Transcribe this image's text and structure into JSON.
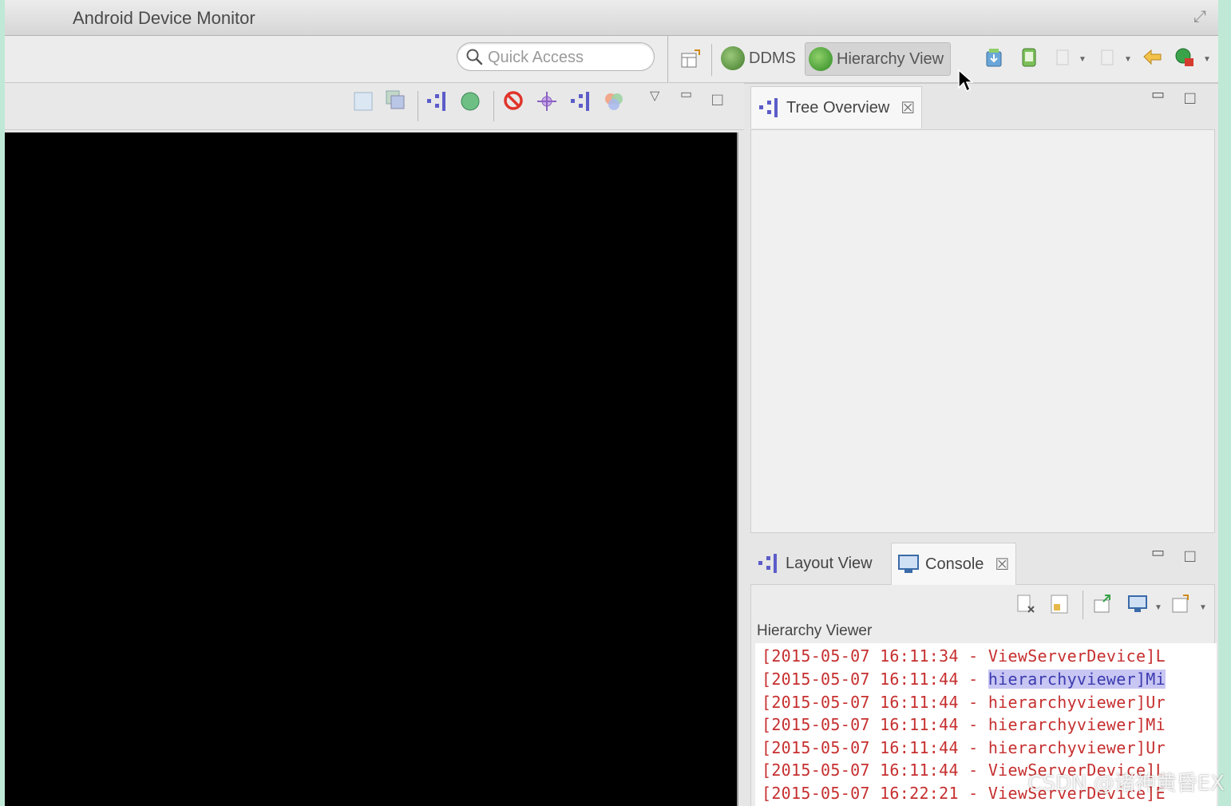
{
  "window": {
    "title": "Android Device Monitor"
  },
  "toolbar": {
    "quick_access_placeholder": "Quick Access",
    "perspectives": [
      {
        "label": "DDMS",
        "icon": "ddms-icon"
      },
      {
        "label": "Hierarchy View",
        "icon": "hierarchy-view-icon",
        "active": true
      }
    ]
  },
  "tree_overview": {
    "tab_label": "Tree Overview"
  },
  "bottom_panel": {
    "tabs": [
      {
        "label": "Layout View"
      },
      {
        "label": "Console",
        "active": true
      }
    ],
    "console_title": "Hierarchy Viewer",
    "log_lines": [
      {
        "prefix": "[2015-05-07 16:11:34 - ",
        "source": "ViewServerDevice]L"
      },
      {
        "prefix": "[2015-05-07 16:11:44 - ",
        "source": "hierarchyviewer]Mi",
        "highlighted": true
      },
      {
        "prefix": "[2015-05-07 16:11:44 - ",
        "source": "hierarchyviewer]Ur"
      },
      {
        "prefix": "[2015-05-07 16:11:44 - ",
        "source": "hierarchyviewer]Mi"
      },
      {
        "prefix": "[2015-05-07 16:11:44 - ",
        "source": "hierarchyviewer]Ur"
      },
      {
        "prefix": "[2015-05-07 16:11:44 - ",
        "source": "ViewServerDevice]L"
      },
      {
        "prefix": "[2015-05-07 16:22:21 - ",
        "source": "ViewServerDevice]E"
      }
    ]
  },
  "watermark": "CSDN @诸神黄昏EX",
  "colors": {
    "log_text": "#c62f2f",
    "highlight_bg": "#c8c6f2",
    "canvas": "#000000"
  }
}
